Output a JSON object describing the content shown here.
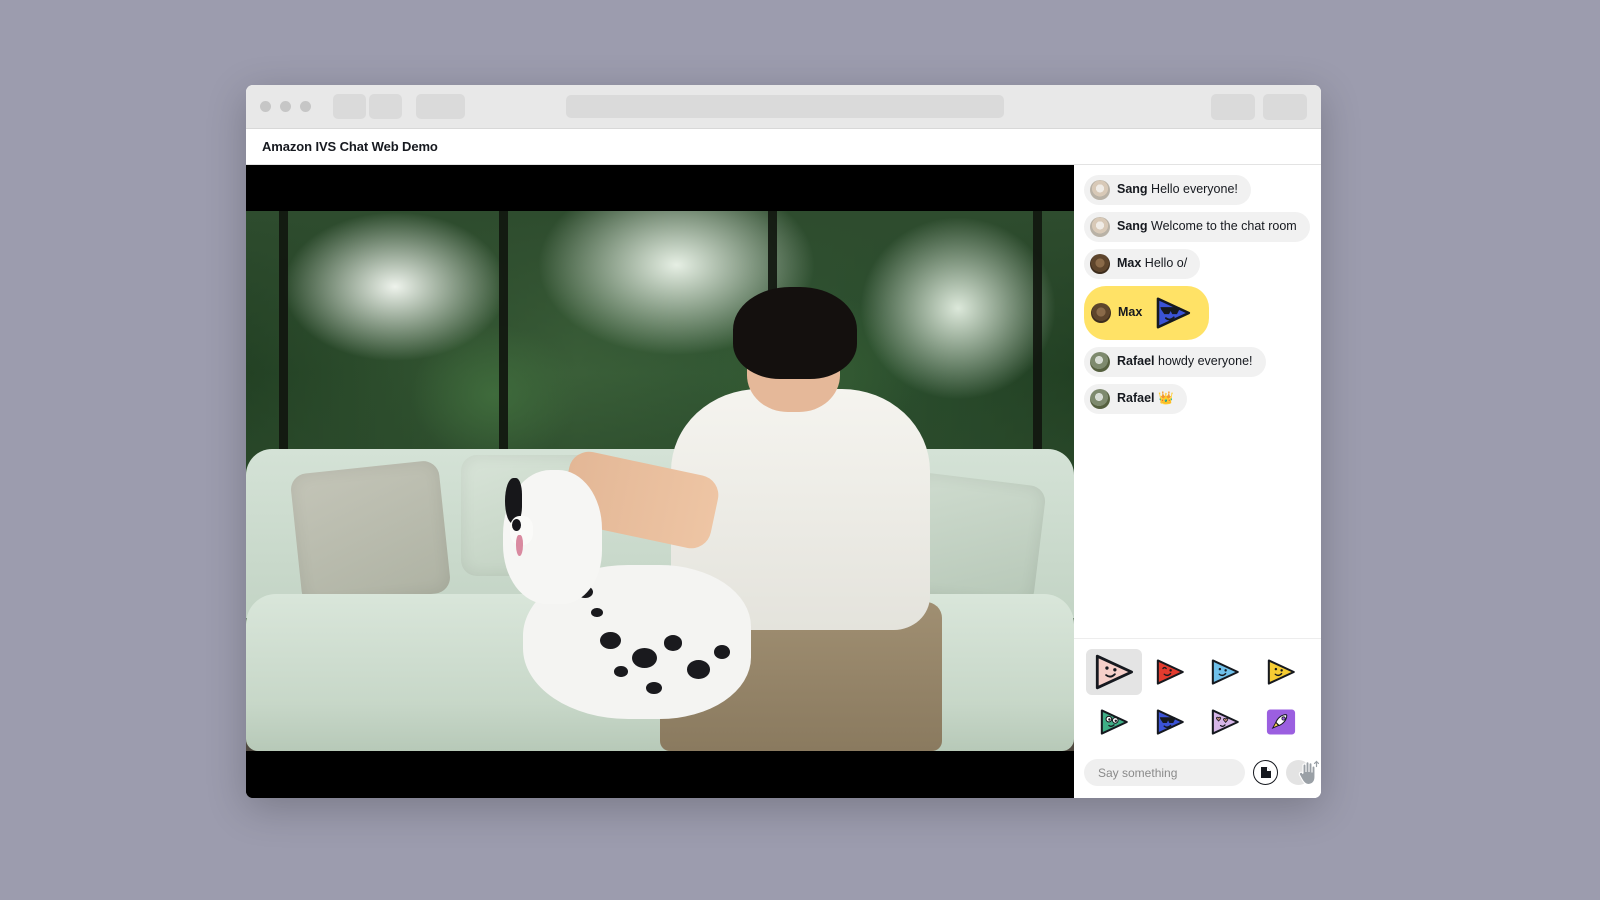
{
  "browser": {
    "traffic_lights": [
      "close",
      "minimize",
      "maximize"
    ],
    "tab_placeholders": 3,
    "right_button_placeholders": 2,
    "omnibox_value": ""
  },
  "app": {
    "title": "Amazon IVS Chat Web Demo"
  },
  "video": {
    "alt": "Man sitting on a light green couch petting a dalmatian dog in front of large garden windows",
    "letterboxed": true
  },
  "chat": {
    "messages": [
      {
        "avatar": "av-fox",
        "user": "Sang",
        "text": "Hello everyone!",
        "type": "text",
        "highlight": false
      },
      {
        "avatar": "av-fox",
        "user": "Sang",
        "text": "Welcome to the chat room",
        "type": "text",
        "highlight": false
      },
      {
        "avatar": "av-bear",
        "user": "Max",
        "text": "Hello o/",
        "type": "text",
        "highlight": false
      },
      {
        "avatar": "av-bear",
        "user": "Max",
        "text": "",
        "type": "sticker",
        "sticker": "blue-sunglasses",
        "highlight": true
      },
      {
        "avatar": "av-camo",
        "user": "Rafael",
        "text": "howdy everyone!",
        "type": "text",
        "highlight": false
      },
      {
        "avatar": "av-camo",
        "user": "Rafael",
        "text": "👑",
        "type": "text",
        "highlight": false
      }
    ],
    "highlight_color": "#ffe266",
    "bubble_color": "#f1f1f1"
  },
  "sticker_picker": {
    "rows": [
      [
        {
          "name": "pink-smile",
          "selected": true,
          "body": "#f6cfc9",
          "accent": "#16191f"
        },
        {
          "name": "red-wink",
          "selected": false,
          "body": "#e23b2e",
          "accent": "#16191f"
        },
        {
          "name": "blue-smile",
          "selected": false,
          "body": "#6fc0ea",
          "accent": "#16191f"
        },
        {
          "name": "yellow-smile",
          "selected": false,
          "body": "#f5cc33",
          "accent": "#16191f"
        }
      ],
      [
        {
          "name": "green-wide-eyes",
          "selected": false,
          "body": "#3fae86",
          "accent": "#ffffff"
        },
        {
          "name": "blue-sunglasses",
          "selected": false,
          "body": "#3b53d6",
          "accent": "#16191f"
        },
        {
          "name": "lavender-heart-eyes",
          "selected": false,
          "body": "#d6b6e8",
          "accent": "#c88a7a"
        },
        {
          "name": "purple-rocket",
          "selected": false,
          "body": "#9b5fe0",
          "accent": "#ffffff"
        }
      ]
    ]
  },
  "composer": {
    "placeholder": "Say something",
    "input_value": "",
    "sticker_button": "document-icon",
    "send_button": "send-icon"
  },
  "cursor": {
    "type": "hand-pointer",
    "visible": true
  }
}
